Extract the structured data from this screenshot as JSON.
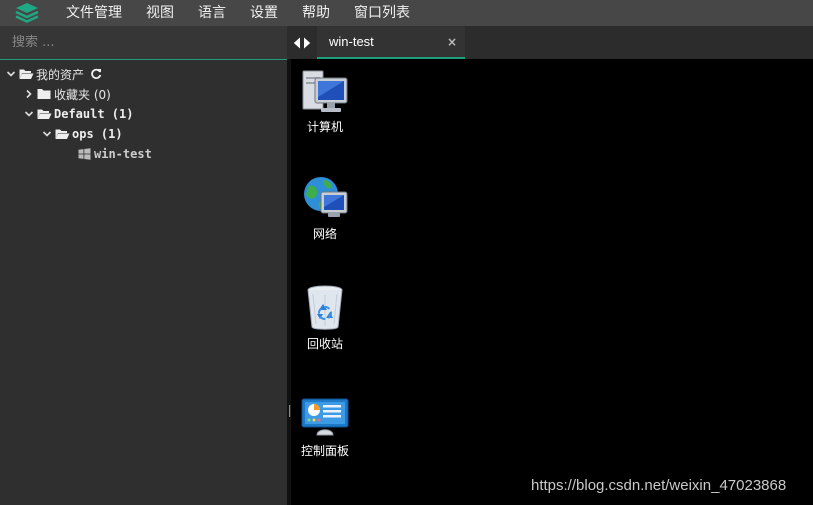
{
  "menubar": {
    "items": [
      "文件管理",
      "视图",
      "语言",
      "设置",
      "帮助",
      "窗口列表"
    ]
  },
  "sidebar": {
    "search_placeholder": "搜索 ...",
    "tree": {
      "root_label": "我的资产",
      "favorites_label": "收藏夹 (0)",
      "default_label": "Default (1)",
      "ops_label": "ops (1)",
      "host_label": "win-test"
    }
  },
  "tabs": [
    {
      "label": "win-test",
      "close": "×"
    }
  ],
  "desktop": {
    "icons": [
      {
        "label": "计算机",
        "icon": "computer-icon"
      },
      {
        "label": "网络",
        "icon": "network-icon"
      },
      {
        "label": "回收站",
        "icon": "recycle-bin-icon"
      },
      {
        "label": "控制面板",
        "icon": "control-panel-icon"
      }
    ]
  },
  "watermark": "https://blog.csdn.net/weixin_47023868",
  "colors": {
    "accent": "#1d9d7c",
    "menubar_bg": "#474747",
    "sidebar_bg": "#2f2f2f",
    "desktop_bg": "#000000"
  }
}
